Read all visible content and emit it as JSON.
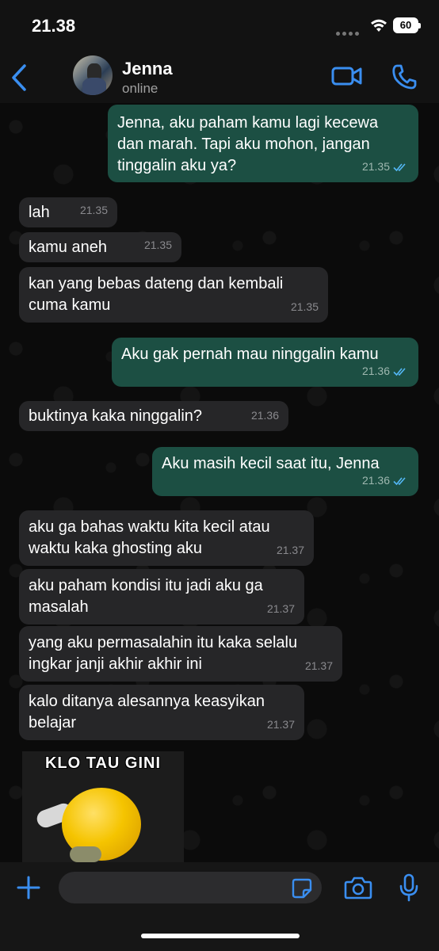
{
  "status_bar": {
    "time": "21.38",
    "battery": "60"
  },
  "header": {
    "name": "Jenna",
    "status": "online"
  },
  "colors": {
    "accent": "#3a8ef0",
    "outgoing_bubble": "#1c4f43",
    "incoming_bubble": "#262628",
    "read_ticks": "#53b7f5"
  },
  "messages": [
    {
      "dir": "out",
      "text": "Jenna, aku paham kamu lagi kecewa\ndan marah. Tapi aku mohon, jangan\ntinggalin aku ya?",
      "time": "21.35",
      "read": true
    },
    {
      "dir": "in",
      "text": "lah",
      "time": "21.35"
    },
    {
      "dir": "in",
      "text": "kamu aneh",
      "time": "21.35"
    },
    {
      "dir": "in",
      "text": "kan yang bebas dateng dan kembali\ncuma kamu",
      "time": "21.35"
    },
    {
      "dir": "out",
      "text": "Aku gak pernah mau ninggalin kamu",
      "time": "21.36",
      "read": true
    },
    {
      "dir": "in",
      "text": "buktinya kaka ninggalin?",
      "time": "21.36"
    },
    {
      "dir": "out",
      "text": "Aku masih kecil saat itu, Jenna",
      "time": "21.36",
      "read": true
    },
    {
      "dir": "in",
      "text": "aku ga bahas waktu kita kecil atau\nwaktu kaka ghosting aku",
      "time": "21.37"
    },
    {
      "dir": "in",
      "text": "aku paham kondisi itu jadi aku ga\nmasalah",
      "time": "21.37"
    },
    {
      "dir": "in",
      "text": "yang aku permasalahin itu kaka selalu\ningkar janji akhir akhir ini",
      "time": "21.37"
    },
    {
      "dir": "in",
      "text": "kalo ditanya alesannya keasyikan\nbelajar",
      "time": "21.37"
    }
  ],
  "sticker": {
    "caption": "KLO TAU GINI"
  },
  "input": {
    "placeholder": ""
  },
  "icons": [
    "back-icon",
    "video-call-icon",
    "phone-icon",
    "plus-icon",
    "sticker-icon",
    "camera-icon",
    "microphone-icon",
    "wifi-icon",
    "double-check-icon"
  ]
}
